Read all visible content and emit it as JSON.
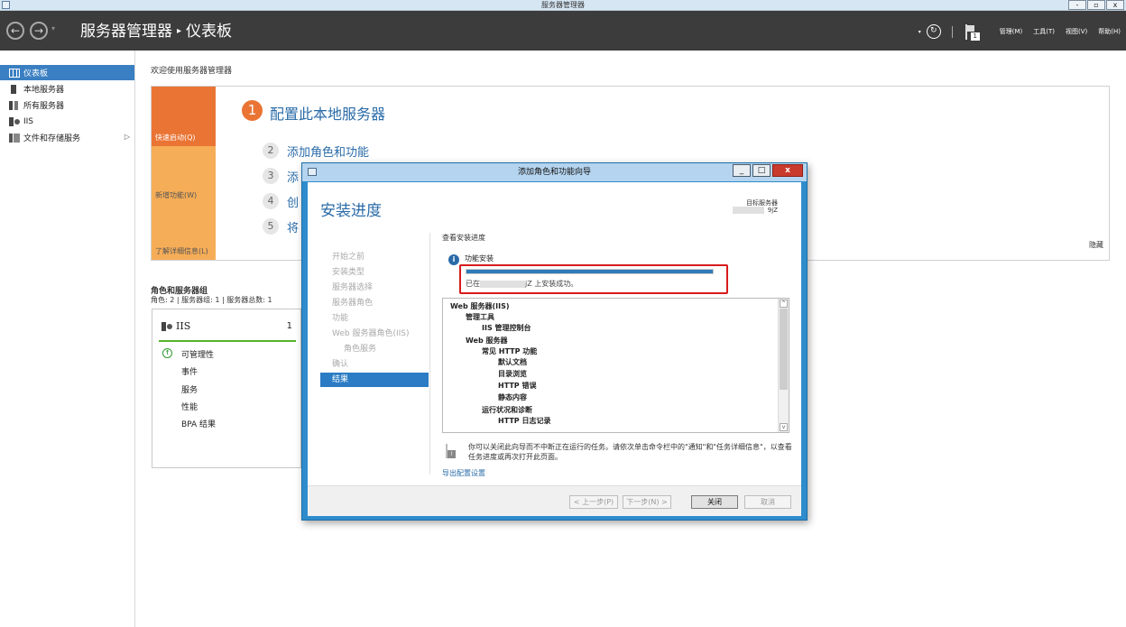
{
  "window": {
    "title": "服务器管理器",
    "controls": [
      "-",
      "▫",
      "x"
    ]
  },
  "nav": {
    "breadcrumb_root": "服务器管理器",
    "breadcrumb_sep": "▸",
    "breadcrumb_page": "仪表板",
    "flag_count": "1",
    "menus": [
      "管理(M)",
      "工具(T)",
      "视图(V)",
      "帮助(H)"
    ]
  },
  "sidebar": {
    "items": [
      {
        "label": "仪表板",
        "icon": "dashboard-icon"
      },
      {
        "label": "本地服务器",
        "icon": "server-icon"
      },
      {
        "label": "所有服务器",
        "icon": "servers-icon"
      },
      {
        "label": "IIS",
        "icon": "iis-icon"
      },
      {
        "label": "文件和存储服务",
        "icon": "storage-icon"
      }
    ],
    "chevron": "▷"
  },
  "welcome": {
    "title": "欢迎使用服务器管理器"
  },
  "quickstart": {
    "tiles": [
      "快速启动(Q)",
      "新增功能(W)",
      "了解详细信息(L)"
    ],
    "steps": [
      {
        "num": "1",
        "text": "配置此本地服务器"
      },
      {
        "num": "2",
        "text": "添加角色和功能"
      },
      {
        "num": "3",
        "text": "添"
      },
      {
        "num": "4",
        "text": "创"
      },
      {
        "num": "5",
        "text": "将"
      }
    ],
    "hide": "隐藏"
  },
  "roles": {
    "title": "角色和服务器组",
    "subtitle": "角色: 2 | 服务器组: 1 | 服务器总数: 1",
    "card": {
      "name": "IIS",
      "count": "1",
      "rows": [
        "可管理性",
        "事件",
        "服务",
        "性能",
        "BPA 结果"
      ]
    }
  },
  "dialog": {
    "title": "添加角色和功能向导",
    "heading": "安装进度",
    "target_label": "目标服务器",
    "target_value": "9jZ",
    "nav": [
      {
        "label": "开始之前"
      },
      {
        "label": "安装类型"
      },
      {
        "label": "服务器选择"
      },
      {
        "label": "服务器角色"
      },
      {
        "label": "功能"
      },
      {
        "label": "Web 服务器角色(IIS)"
      },
      {
        "label": "角色服务"
      },
      {
        "label": "确认"
      },
      {
        "label": "结果"
      }
    ],
    "view_progress": "查看安装进度",
    "feature_install": "功能安装",
    "progress": 1.0,
    "install_msg_prefix": "已在",
    "install_msg_suffix": "jZ 上安装成功。",
    "tree": [
      "Web 服务器(IIS)",
      "管理工具",
      "IIS 管理控制台",
      "Web 服务器",
      "常见 HTTP 功能",
      "默认文档",
      "目录浏览",
      "HTTP 错误",
      "静态内容",
      "运行状况和诊断",
      "HTTP 日志记录"
    ],
    "note": "你可以关闭此向导而不中断正在运行的任务。请依次单击命令栏中的\"通知\"和\"任务详细信息\"，以查看任务进度或再次打开此页面。",
    "export": "导出配置设置",
    "buttons": {
      "prev": "< 上一步(P)",
      "next": "下一步(N) >",
      "close": "关闭",
      "cancel": "取消"
    }
  },
  "colors": {
    "accent_blue": "#2a6ba8",
    "orange": "#ea7434",
    "highlight_red": "#d81b1b",
    "status_green": "#57b22c"
  }
}
